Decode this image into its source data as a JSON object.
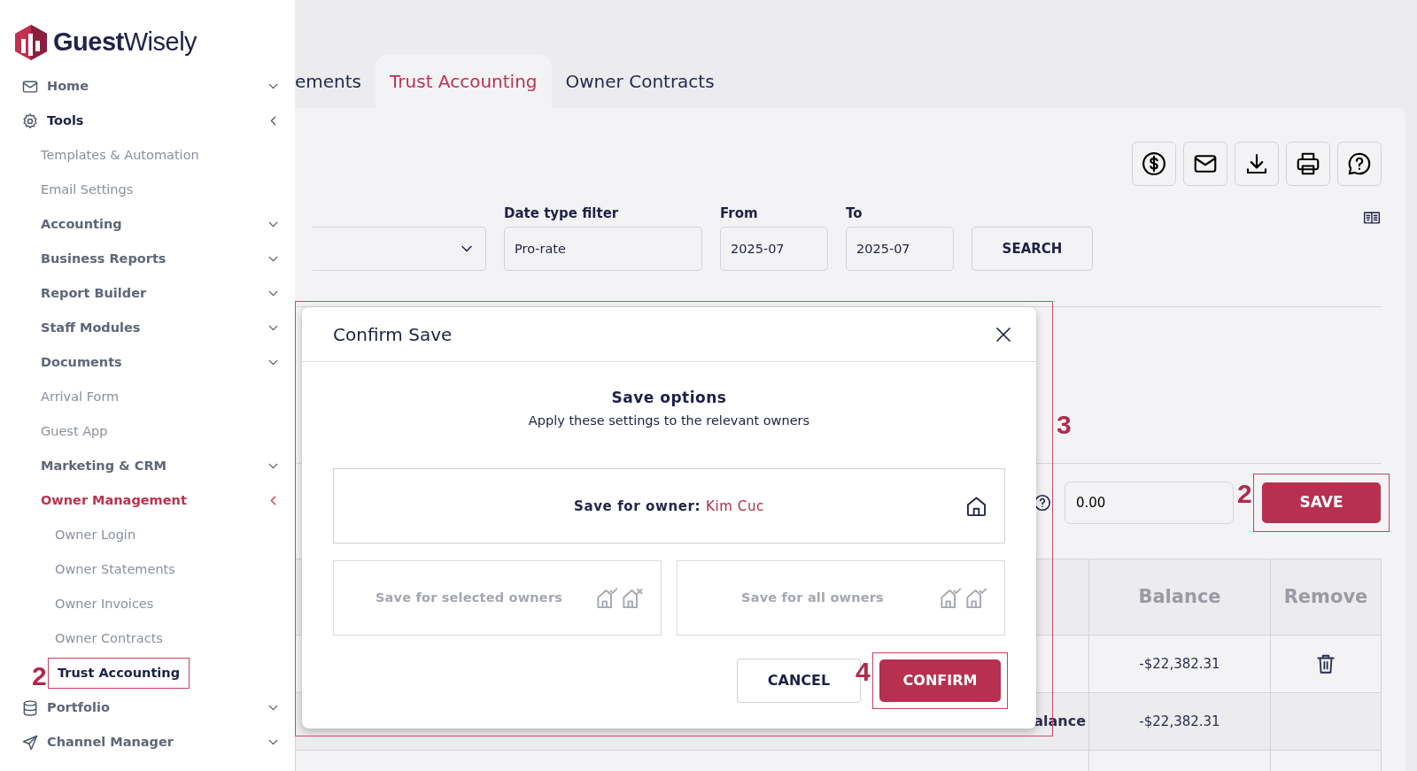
{
  "logo": {
    "text": "**Guest**Wisely"
  },
  "sidebar": {
    "items": [
      {
        "label": "Home",
        "kind": "group",
        "expanded": false,
        "selected": false
      },
      {
        "label": "Tools",
        "kind": "group",
        "expanded": true,
        "selected": false,
        "children": [
          {
            "label": "Templates & Automation",
            "kind": "link",
            "selected": false
          },
          {
            "label": "Email Settings",
            "kind": "link",
            "selected": false
          },
          {
            "label": "Accounting",
            "kind": "group",
            "expanded": false,
            "selected": false
          },
          {
            "label": "Business Reports",
            "kind": "group",
            "expanded": false,
            "selected": false
          },
          {
            "label": "Report Builder",
            "kind": "group",
            "expanded": false,
            "selected": false
          },
          {
            "label": "Staff Modules",
            "kind": "group",
            "expanded": false,
            "selected": false
          },
          {
            "label": "Documents",
            "kind": "group",
            "expanded": false,
            "selected": false
          },
          {
            "label": "Arrival Form",
            "kind": "link",
            "selected": false
          },
          {
            "label": "Guest App",
            "kind": "link",
            "selected": false
          },
          {
            "label": "Marketing & CRM",
            "kind": "group",
            "expanded": false,
            "selected": false
          },
          {
            "label": "Owner Management",
            "kind": "group",
            "expanded": true,
            "selected": true,
            "children": [
              {
                "label": "Owner Login",
                "kind": "link",
                "selected": false
              },
              {
                "label": "Owner Statements",
                "kind": "link",
                "selected": false
              },
              {
                "label": "Owner Invoices",
                "kind": "link",
                "selected": false
              },
              {
                "label": "Owner Contracts",
                "kind": "link",
                "selected": false
              },
              {
                "label": "Trust Accounting",
                "kind": "link",
                "selected": true,
                "annotation": "2"
              }
            ]
          }
        ]
      },
      {
        "label": "Portfolio",
        "kind": "group",
        "expanded": false,
        "selected": false
      },
      {
        "label": "Channel Manager",
        "kind": "group",
        "expanded": false,
        "selected": false
      }
    ]
  },
  "tabs": [
    {
      "label": "ements",
      "selected": false
    },
    {
      "label": "Trust Accounting",
      "selected": true
    },
    {
      "label": "Owner Contracts",
      "selected": false
    }
  ],
  "filters": {
    "date_type": {
      "label": "Date type filter",
      "value": "Pro-rate"
    },
    "from": {
      "label": "From",
      "value": "2025-07"
    },
    "to": {
      "label": "To",
      "value": "2025-07"
    },
    "search_button": "SEARCH"
  },
  "amount": {
    "value": "0.00"
  },
  "save_button": {
    "label": "SAVE",
    "annotation": "2"
  },
  "table": {
    "columns": [
      "Balance",
      "Remove"
    ],
    "rows": [
      {
        "column_1": "",
        "balance": "-$22,382.31",
        "removable": true
      },
      {
        "column_1": "alance",
        "balance": "-$22,382.31",
        "removable": false
      }
    ]
  },
  "modal": {
    "title": "Confirm Save",
    "annotation": "3",
    "heading": "Save options",
    "subtitle": "Apply these settings to the relevant owners",
    "options": [
      {
        "label": "Save for owner:",
        "owner": "Kim Cuc",
        "disabled": false
      },
      {
        "label": "Save for selected owners",
        "disabled": true
      },
      {
        "label": "Save for all owners",
        "disabled": true
      }
    ],
    "cancel_button": "CANCEL",
    "confirm_button": {
      "label": "CONFIRM",
      "annotation": "4"
    }
  }
}
